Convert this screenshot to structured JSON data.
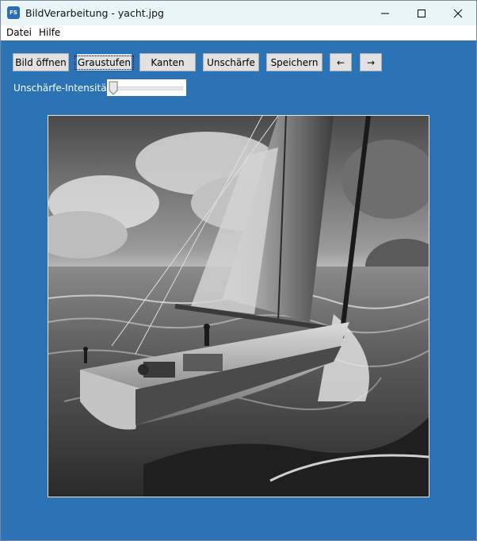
{
  "window": {
    "title": "BildVerarbeitung - yacht.jpg",
    "app_icon_text": "FS"
  },
  "menu": {
    "items": [
      "Datei",
      "Hilfe"
    ]
  },
  "toolbar": {
    "buttons": [
      "Bild öffnen",
      "Graustufen",
      "Kanten",
      "Unschärfe",
      "Speichern",
      "←",
      "→"
    ]
  },
  "blur": {
    "label": "Unschärfe-Intensität",
    "value": 0
  },
  "image": {
    "alt": "yacht.jpg"
  },
  "colors": {
    "background": "#2b73b4",
    "titlebar": "#e9f5f7",
    "button_face": "#e1e1e1",
    "focus_border": "#0078d7"
  }
}
